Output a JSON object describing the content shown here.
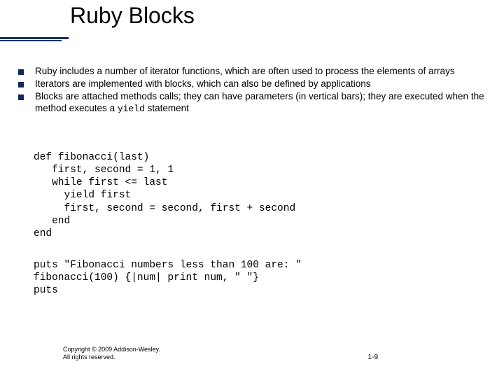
{
  "title": "Ruby Blocks",
  "bullets": [
    {
      "text": "Ruby includes a number of iterator functions, which are often used to process the elements of arrays"
    },
    {
      "text": "Iterators are implemented with blocks, which can also be defined by applications"
    },
    {
      "text_pre": "Blocks are attached methods calls; they can have parameters (in vertical bars); they are executed when the method executes a ",
      "code": "yield",
      "text_post": " statement"
    }
  ],
  "code1": "def fibonacci(last)\n   first, second = 1, 1\n   while first <= last\n     yield first\n     first, second = second, first + second\n   end\nend",
  "code2": "puts \"Fibonacci numbers less than 100 are: \"\nfibonacci(100) {|num| print num, \" \"}\nputs",
  "footer": {
    "copyright": "Copyright © 2009 Addison-Wesley. All rights reserved.",
    "pagenum": "1-9"
  }
}
